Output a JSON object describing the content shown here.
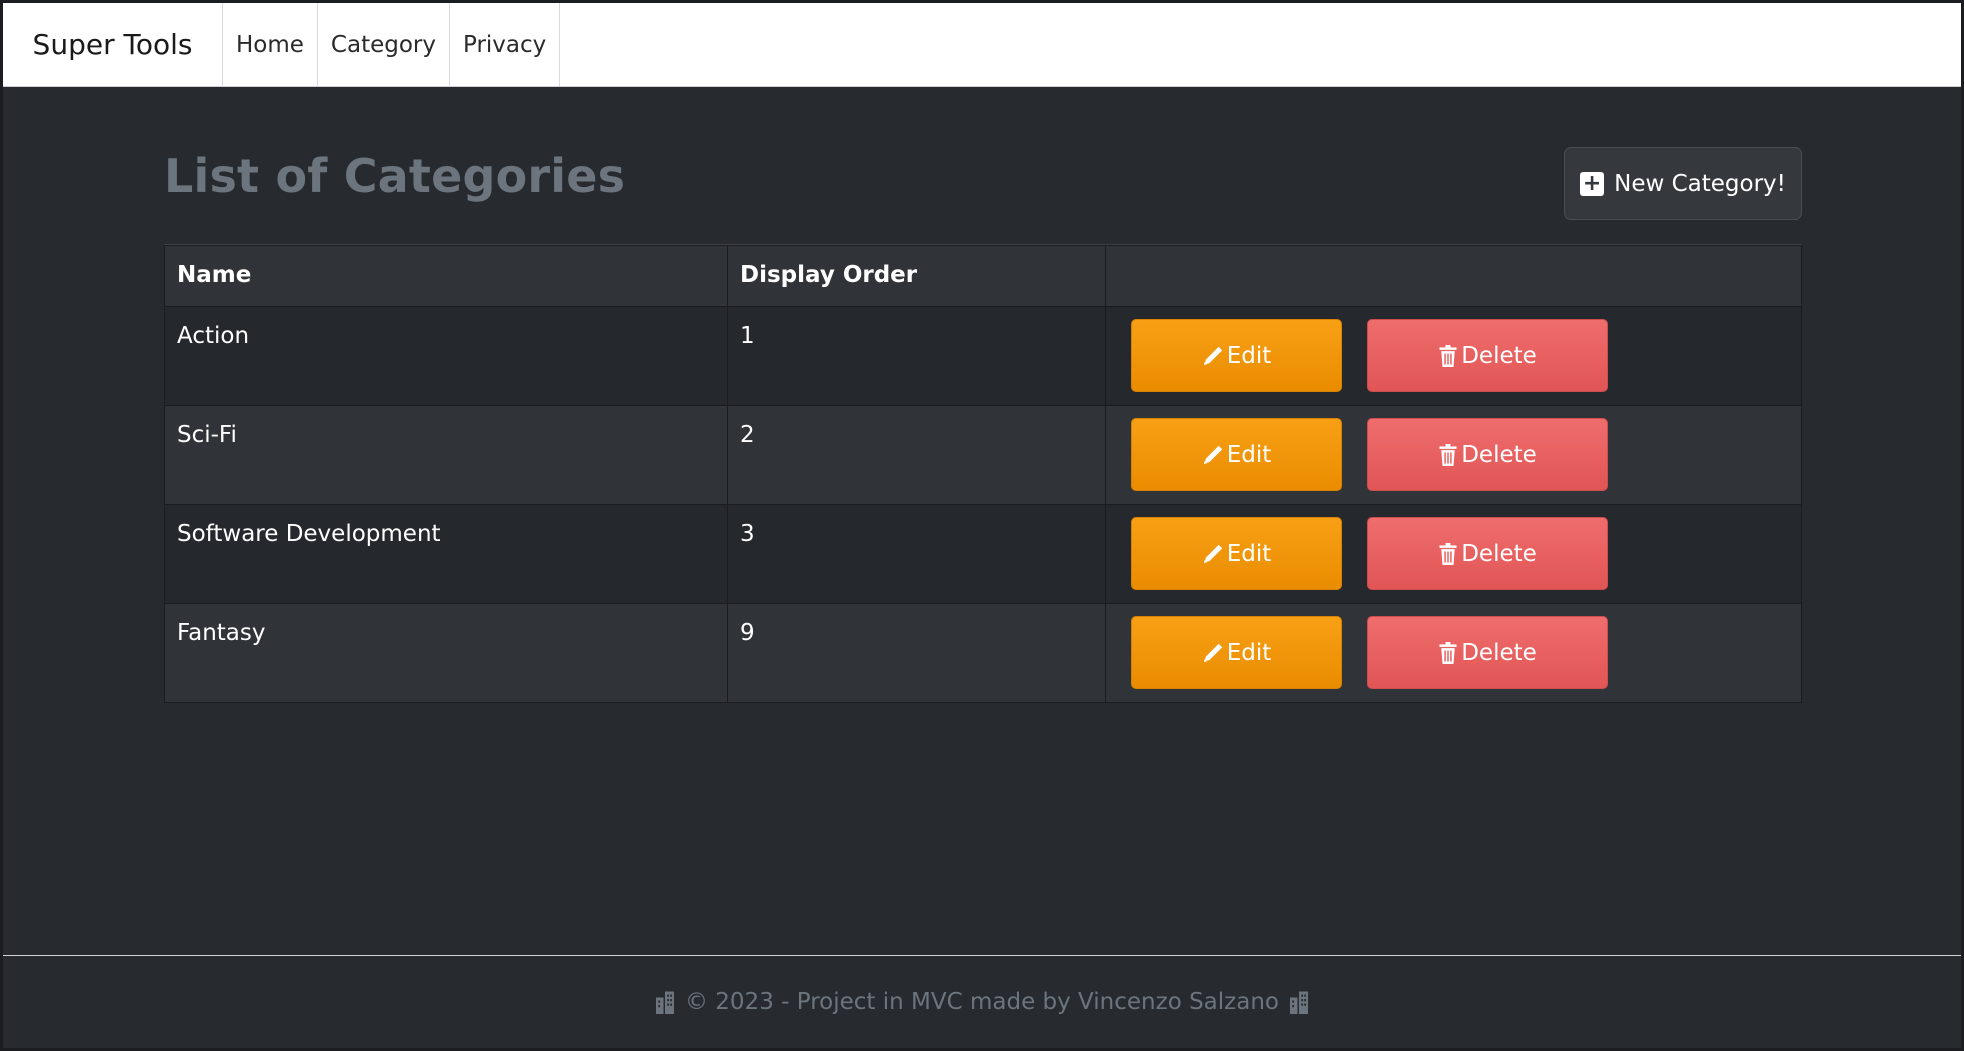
{
  "navbar": {
    "brand": "Super Tools",
    "items": [
      {
        "label": "Home"
      },
      {
        "label": "Category"
      },
      {
        "label": "Privacy"
      }
    ]
  },
  "main": {
    "title": "List of Categories",
    "new_button_label": "New Category!",
    "table": {
      "headers": [
        "Name",
        "Display Order",
        ""
      ],
      "rows": [
        {
          "name": "Action",
          "order": "1"
        },
        {
          "name": "Sci-Fi",
          "order": "2"
        },
        {
          "name": "Software Development",
          "order": "3"
        },
        {
          "name": "Fantasy",
          "order": "9"
        }
      ],
      "edit_label": "Edit",
      "delete_label": "Delete"
    }
  },
  "footer": {
    "text": "© 2023 - Project in MVC made by Vincenzo Salzano",
    "icon": "building-icon"
  },
  "colors": {
    "background": "#272a2f",
    "edit": "#f39410",
    "delete": "#e85f5f"
  }
}
